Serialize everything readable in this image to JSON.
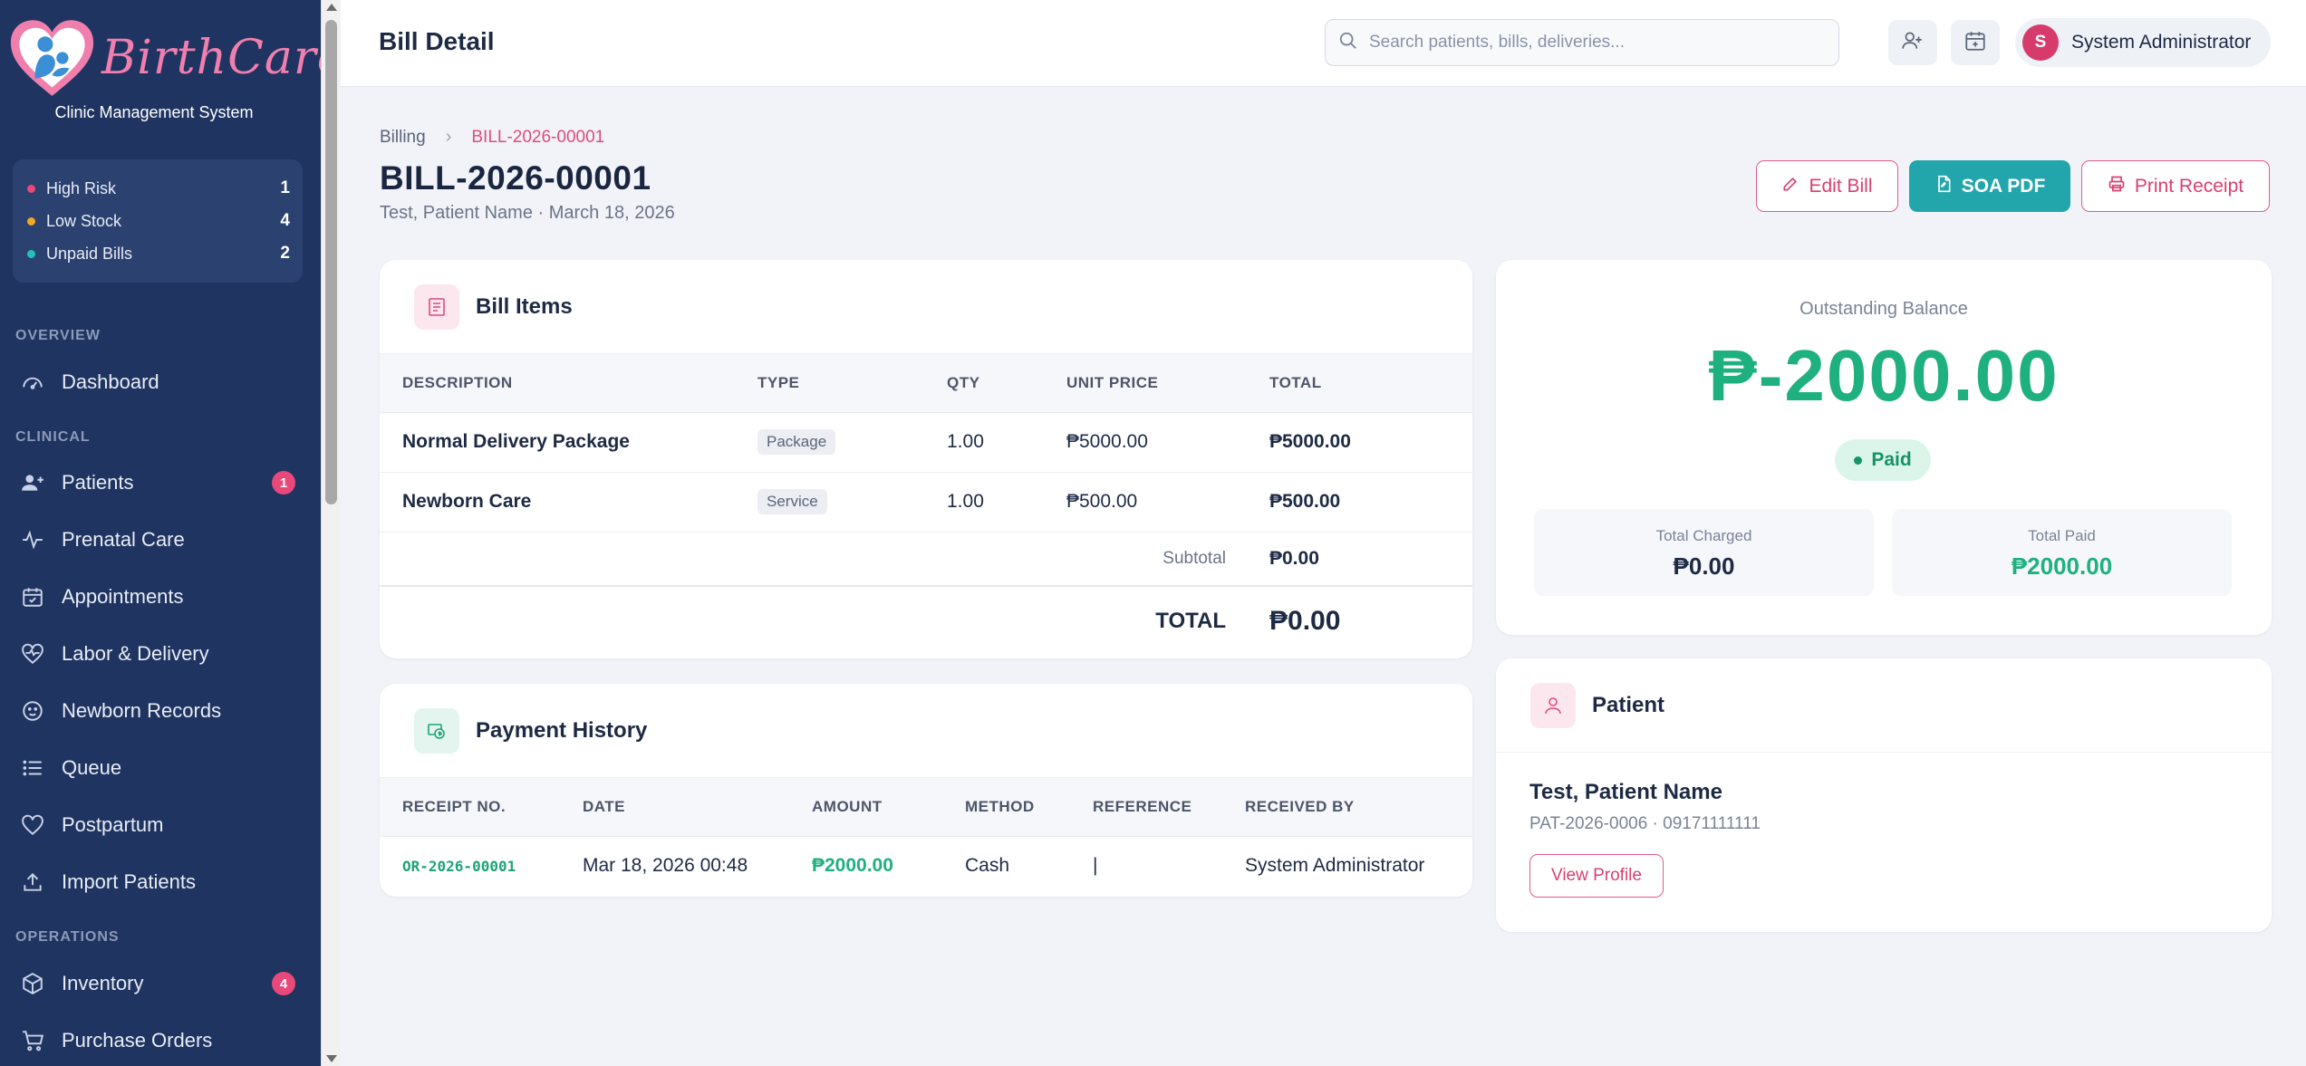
{
  "brand": {
    "name": "BirthCare",
    "subtitle": "Clinic Management System"
  },
  "alerts": [
    {
      "label": "High Risk",
      "count": "1",
      "color": "#e8487a"
    },
    {
      "label": "Low Stock",
      "count": "4",
      "color": "#f5a623"
    },
    {
      "label": "Unpaid Bills",
      "count": "2",
      "color": "#23c2b8"
    }
  ],
  "nav": {
    "overview_label": "OVERVIEW",
    "clinical_label": "CLINICAL",
    "operations_label": "OPERATIONS",
    "items": [
      {
        "label": "Dashboard",
        "icon": "dashboard-icon"
      },
      {
        "label": "Patients",
        "icon": "patients-icon",
        "badge": "1"
      },
      {
        "label": "Prenatal Care",
        "icon": "activity-icon"
      },
      {
        "label": "Appointments",
        "icon": "calendar-check-icon"
      },
      {
        "label": "Labor & Delivery",
        "icon": "heart-pulse-icon"
      },
      {
        "label": "Newborn Records",
        "icon": "baby-icon"
      },
      {
        "label": "Queue",
        "icon": "list-icon"
      },
      {
        "label": "Postpartum",
        "icon": "heart-icon"
      },
      {
        "label": "Import Patients",
        "icon": "upload-icon"
      },
      {
        "label": "Inventory",
        "icon": "box-icon",
        "badge": "4"
      },
      {
        "label": "Purchase Orders",
        "icon": "cart-icon"
      }
    ]
  },
  "header": {
    "title": "Bill Detail",
    "search_placeholder": "Search patients, bills, deliveries...",
    "user_initial": "S",
    "user_name": "System Administrator"
  },
  "page": {
    "breadcrumb_parent": "Billing",
    "breadcrumb_current": "BILL-2026-00001",
    "title": "BILL-2026-00001",
    "subtitle": "Test, Patient Name · March 18, 2026",
    "edit_label": "Edit Bill",
    "soa_label": "SOA PDF",
    "print_label": "Print Receipt"
  },
  "bill_items": {
    "title": "Bill Items",
    "columns": [
      "DESCRIPTION",
      "TYPE",
      "QTY",
      "UNIT PRICE",
      "TOTAL"
    ],
    "rows": [
      {
        "description": "Normal Delivery Package",
        "type": "Package",
        "qty": "1.00",
        "unit_price": "₱5000.00",
        "total": "₱5000.00"
      },
      {
        "description": "Newborn Care",
        "type": "Service",
        "qty": "1.00",
        "unit_price": "₱500.00",
        "total": "₱500.00"
      }
    ],
    "subtotal_label": "Subtotal",
    "subtotal_value": "₱0.00",
    "total_label": "TOTAL",
    "total_value": "₱0.00"
  },
  "payments": {
    "title": "Payment History",
    "columns": [
      "RECEIPT NO.",
      "DATE",
      "AMOUNT",
      "METHOD",
      "REFERENCE",
      "RECEIVED BY"
    ],
    "rows": [
      {
        "receipt": "OR-2026-00001",
        "date": "Mar 18, 2026 00:48",
        "amount": "₱2000.00",
        "method": "Cash",
        "reference": "|",
        "received_by": "System Administrator"
      }
    ]
  },
  "balance": {
    "label": "Outstanding Balance",
    "amount": "₱-2000.00",
    "status": "Paid",
    "charged_label": "Total Charged",
    "charged_value": "₱0.00",
    "paid_label": "Total Paid",
    "paid_value": "₱2000.00"
  },
  "patient": {
    "title": "Patient",
    "name": "Test, Patient Name",
    "meta": "PAT-2026-0006 · 09171111111",
    "view_label": "View Profile"
  },
  "colors": {
    "sidebar": "#1f3461",
    "accent_pink": "#e04c7c",
    "accent_teal": "#22a6ab",
    "success": "#1fb07f"
  }
}
